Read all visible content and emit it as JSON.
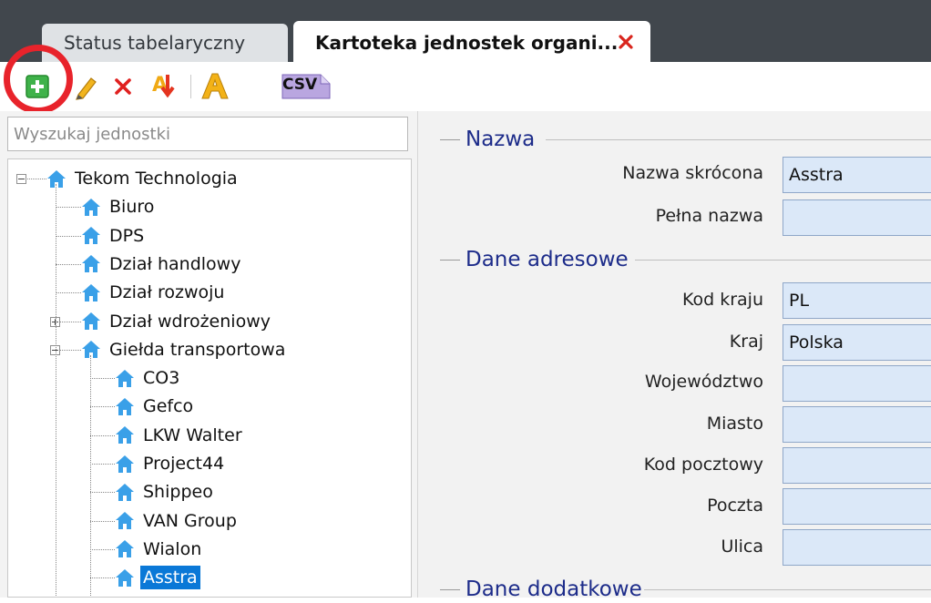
{
  "tabs": [
    {
      "label": "Status tabelaryczny",
      "active": false
    },
    {
      "label": "Kartoteka jednostek organi...",
      "active": true
    }
  ],
  "toolbar": {
    "buttons": [
      {
        "name": "add-button",
        "icon": "plus-icon"
      },
      {
        "name": "edit-button",
        "icon": "pencil-icon"
      },
      {
        "name": "delete-button",
        "icon": "delete-x-icon"
      },
      {
        "name": "sort-button",
        "icon": "sort-arrow-icon"
      },
      {
        "name": "font-button",
        "icon": "font-a-icon"
      },
      {
        "name": "csv-export-button",
        "icon": "csv-file-icon",
        "label": "CSV"
      }
    ]
  },
  "search": {
    "placeholder": "Wyszukaj jednostki"
  },
  "tree": [
    {
      "label": "Tekom Technologia",
      "level": 0,
      "expander": "-"
    },
    {
      "label": "Biuro",
      "level": 1
    },
    {
      "label": "DPS",
      "level": 1
    },
    {
      "label": "Dział handlowy",
      "level": 1
    },
    {
      "label": "Dział rozwoju",
      "level": 1
    },
    {
      "label": "Dział wdrożeniowy",
      "level": 1,
      "expander": "+"
    },
    {
      "label": "Giełda transportowa",
      "level": 1,
      "expander": "-"
    },
    {
      "label": "CO3",
      "level": 2
    },
    {
      "label": "Gefco",
      "level": 2
    },
    {
      "label": "LKW Walter",
      "level": 2
    },
    {
      "label": "Project44",
      "level": 2
    },
    {
      "label": "Shippeo",
      "level": 2
    },
    {
      "label": "VAN Group",
      "level": 2
    },
    {
      "label": "Wialon",
      "level": 2
    },
    {
      "label": "Asstra",
      "level": 2,
      "selected": true
    }
  ],
  "form": {
    "section_name": "Nazwa",
    "short_name_label": "Nazwa skrócona",
    "short_name_value": "Asstra",
    "full_name_label": "Pełna nazwa",
    "full_name_value": "",
    "section_address": "Dane adresowe",
    "country_code_label": "Kod kraju",
    "country_code_value": "PL",
    "country_label": "Kraj",
    "country_value": "Polska",
    "voivodeship_label": "Województwo",
    "voivodeship_value": "",
    "city_label": "Miasto",
    "city_value": "",
    "postal_code_label": "Kod pocztowy",
    "postal_code_value": "",
    "post_office_label": "Poczta",
    "post_office_value": "",
    "street_label": "Ulica",
    "street_value": "",
    "section_additional": "Dane dodatkowe"
  },
  "colors": {
    "accent_red": "#e8232b",
    "selection_blue": "#0a78d7",
    "section_title_blue": "#1d2c8a",
    "house_icon_blue": "#3aa0e8"
  }
}
